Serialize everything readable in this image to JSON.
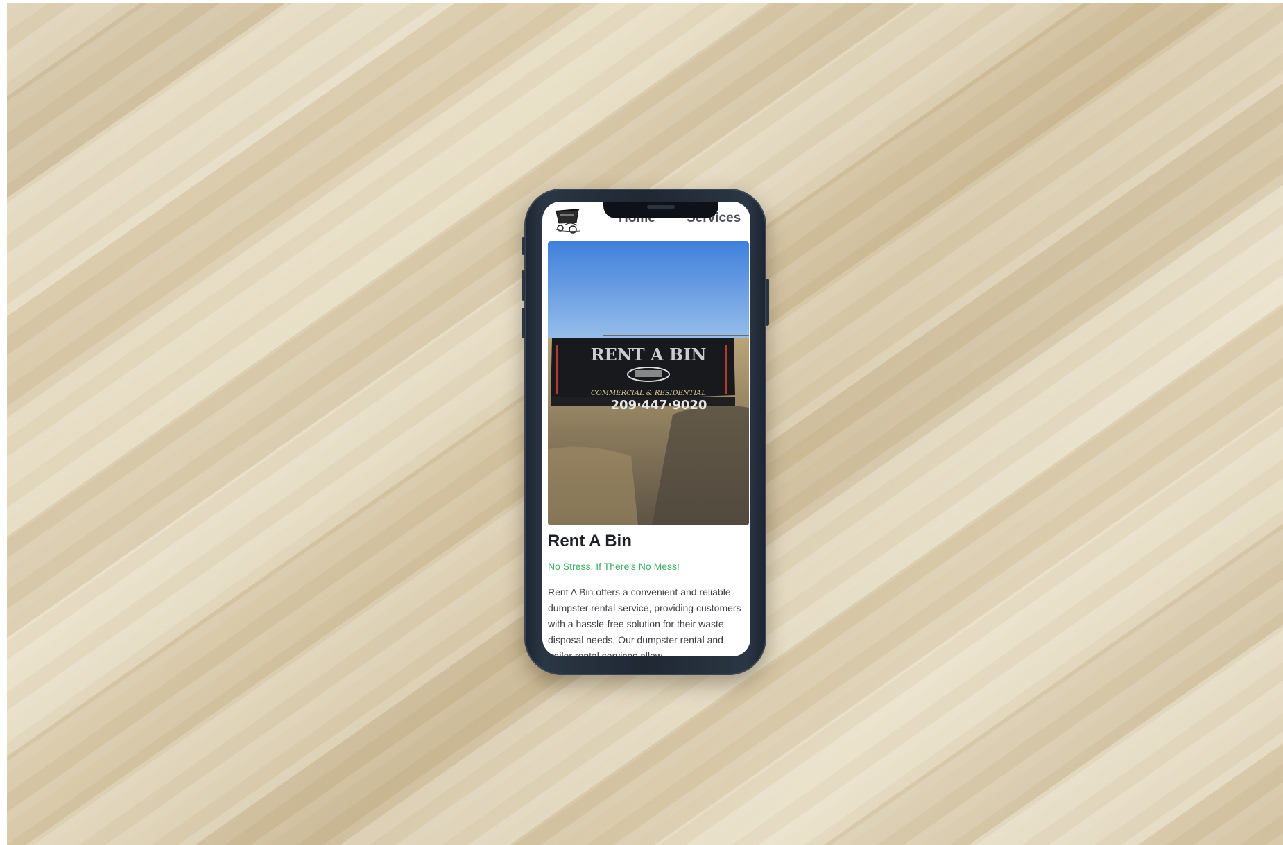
{
  "nav": {
    "links": [
      {
        "label": "Home"
      },
      {
        "label": "Services"
      }
    ]
  },
  "hero": {
    "sign_title": "RENT A BIN",
    "sign_subtitle": "COMMERCIAL & RESIDENTIAL",
    "sign_phone": "209·447·9020"
  },
  "content": {
    "title": "Rent A Bin",
    "tagline": "No Stress, If There's No Mess!",
    "description": "Rent A Bin offers a convenient and reliable dumpster rental service, providing customers with a hassle-free solution for their waste disposal needs. Our dumpster rental and trailer rental services allow"
  },
  "colors": {
    "tagline": "#3fae62",
    "heading": "#1e2228",
    "nav_text": "#4a4f58"
  },
  "icons": [
    "dumpster-logo-icon"
  ]
}
